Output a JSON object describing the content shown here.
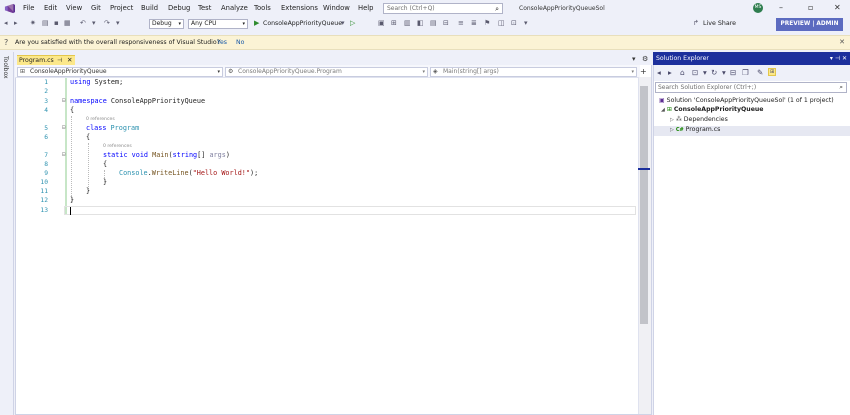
{
  "menu": {
    "items": [
      "File",
      "Edit",
      "View",
      "Git",
      "Project",
      "Build",
      "Debug",
      "Test",
      "Analyze",
      "Tools",
      "Extensions",
      "Window",
      "Help"
    ],
    "search_placeholder": "Search (Ctrl+Q)",
    "solution_title": "ConsoleAppPriorityQueueSol",
    "avatar_initials": "MS"
  },
  "toolbar": {
    "config": "Debug",
    "platform": "Any CPU",
    "run_target": "ConsoleAppPriorityQueue",
    "live_share": "Live Share",
    "preview_badge": "PREVIEW | ADMIN"
  },
  "infobar": {
    "message": "Are you satisfied with the overall responsiveness of Visual Studio?",
    "yes": "Yes",
    "no": "No"
  },
  "toolbox": {
    "label": "Toolbox"
  },
  "editor": {
    "tab_label": "Program.cs",
    "nav_project": "ConsoleAppPriorityQueue",
    "nav_class": "ConsoleAppPriorityQueue.Program",
    "nav_member": "Main(string[] args)",
    "refs_label": "0 references",
    "line_numbers": [
      "1",
      "2",
      "3",
      "4",
      "5",
      "6",
      "7",
      "8",
      "9",
      "10",
      "11",
      "12",
      "13"
    ],
    "code": {
      "using_kw": "using",
      "using_ns": " System;",
      "namespace_kw": "namespace",
      "namespace_name": " ConsoleAppPriorityQueue",
      "open_brace": "{",
      "close_brace": "}",
      "class_kw": "class",
      "class_name": " Program",
      "static_kw": "static",
      "void_kw": " void ",
      "main_name": "Main",
      "paren_open": "(",
      "string_kw": "string",
      "args_rest": "[] ",
      "args_name": "args",
      "paren_close": ")",
      "console": "Console",
      "dot": ".",
      "writeline": "WriteLine",
      "hello": "\"Hello World!\"",
      "end": ");"
    }
  },
  "solution_explorer": {
    "title": "Solution Explorer",
    "search_placeholder": "Search Solution Explorer (Ctrl+;)",
    "solution_label": "Solution 'ConsoleAppPriorityQueueSol' (1 of 1 project)",
    "project_label": "ConsoleAppPriorityQueue",
    "dependencies_label": "Dependencies",
    "file_label": "Program.cs"
  },
  "colors": {
    "accent": "#1c2f9c",
    "tab_active": "#fce88a",
    "keyword": "#0000ff",
    "type": "#2b91af",
    "string": "#a31515"
  }
}
